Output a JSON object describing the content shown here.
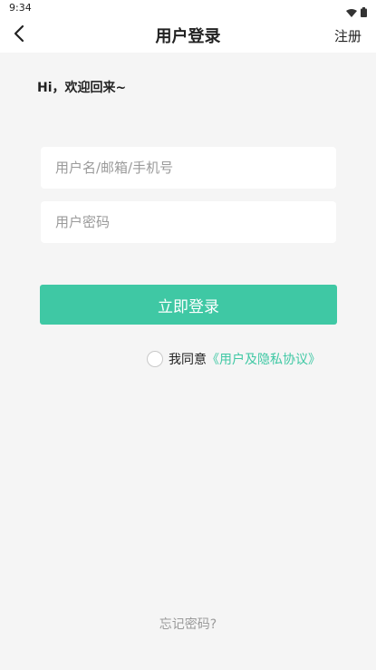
{
  "status_bar": {
    "time": "9:34",
    "icons": [
      "wifi-icon",
      "battery-icon"
    ]
  },
  "header": {
    "back_icon": "chevron-left-icon",
    "title": "用户登录",
    "register_label": "注册"
  },
  "greeting": "Hi，欢迎回来~",
  "form": {
    "username_placeholder": "用户名/邮箱/手机号",
    "username_value": "",
    "password_placeholder": "用户密码",
    "password_value": "",
    "login_label": "立即登录"
  },
  "agreement": {
    "checked": false,
    "prefix": "我同意",
    "link_text": "《用户及隐私协议》"
  },
  "forgot_password_label": "忘记密码?",
  "colors": {
    "accent": "#3fc8a4",
    "background": "#f5f5f5"
  }
}
